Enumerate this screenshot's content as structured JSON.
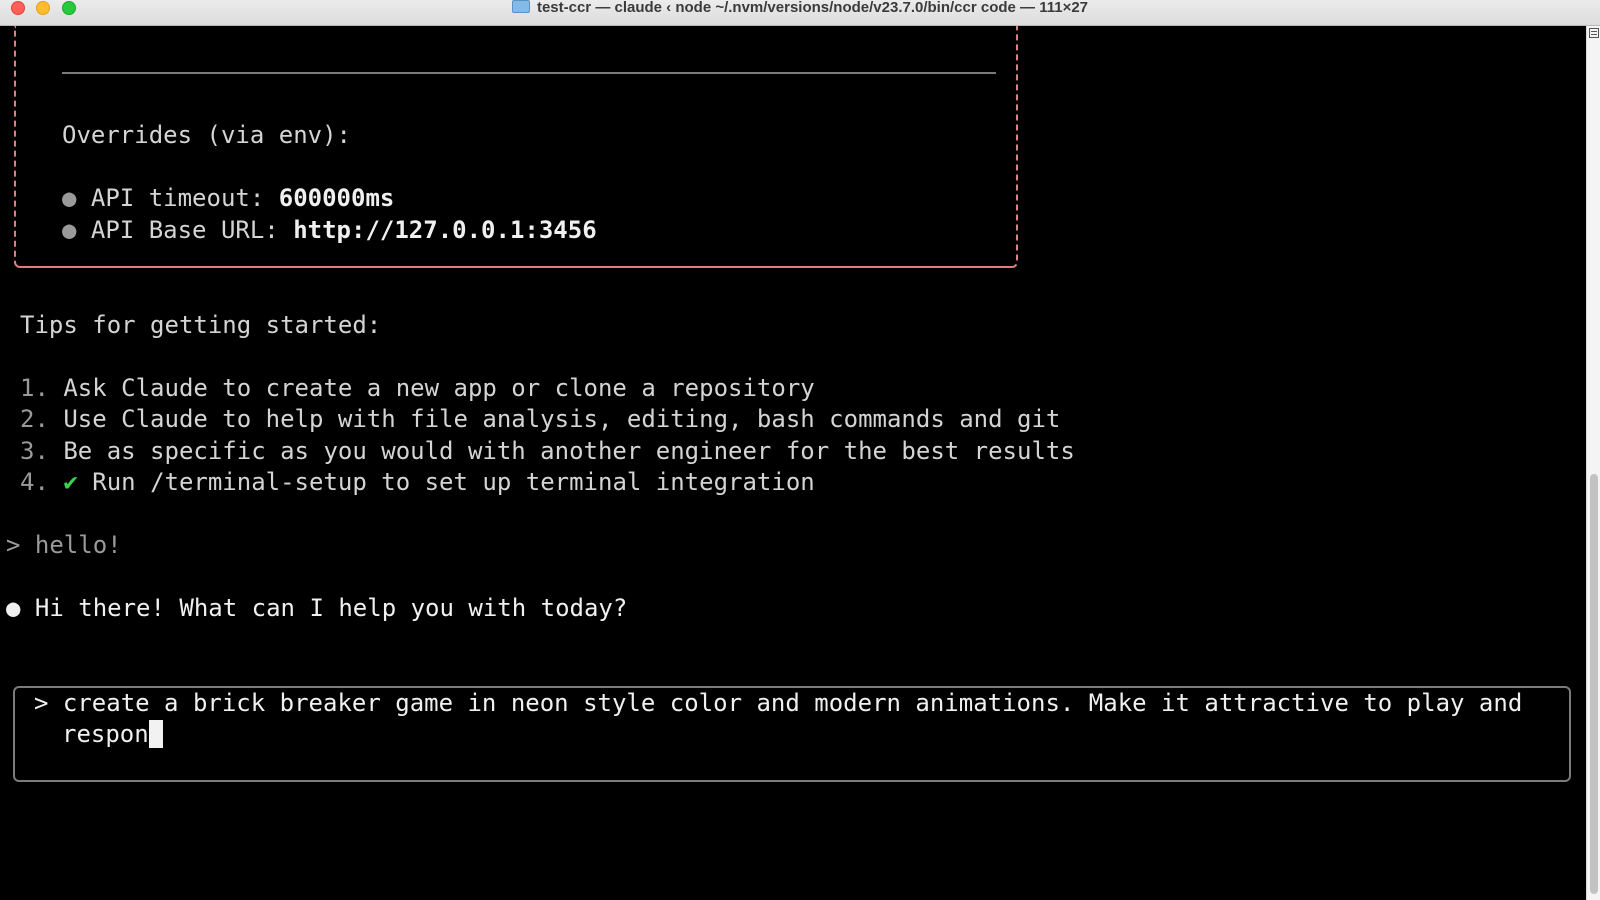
{
  "window": {
    "title": "test-ccr — claude ‹ node ~/.nvm/versions/node/v23.7.0/bin/ccr code — 111×27"
  },
  "welcome": {
    "overrides_heading": "Overrides (via env):",
    "bullet": "●",
    "timeout_label": "API timeout: ",
    "timeout_value": "600000ms",
    "base_url_label": "API Base URL: ",
    "base_url_value": "http://127.0.0.1:3456"
  },
  "tips": {
    "heading": "Tips for getting started:",
    "items": [
      {
        "number": "1.",
        "check": "",
        "text": "Ask Claude to create a new app or clone a repository"
      },
      {
        "number": "2.",
        "check": "",
        "text": "Use Claude to help with file analysis, editing, bash commands and git"
      },
      {
        "number": "3.",
        "check": "",
        "text": "Be as specific as you would with another engineer for the best results"
      },
      {
        "number": "4.",
        "check": "✔",
        "text": "Run /terminal-setup to set up terminal integration"
      }
    ]
  },
  "conversation": {
    "user_prompt_symbol": ">",
    "user_message": "hello!",
    "assistant_bullet": "●",
    "assistant_message": "Hi there! What can I help you with today?"
  },
  "input": {
    "prompt_symbol": ">",
    "line1": "create a brick breaker game in neon style color and modern animations. Make it attractive to play and",
    "line2": "respon"
  },
  "colors": {
    "background": "#000000",
    "welcome_border": "#d98080",
    "input_border": "#7c7c7c",
    "check_green": "#3fcf4f"
  }
}
